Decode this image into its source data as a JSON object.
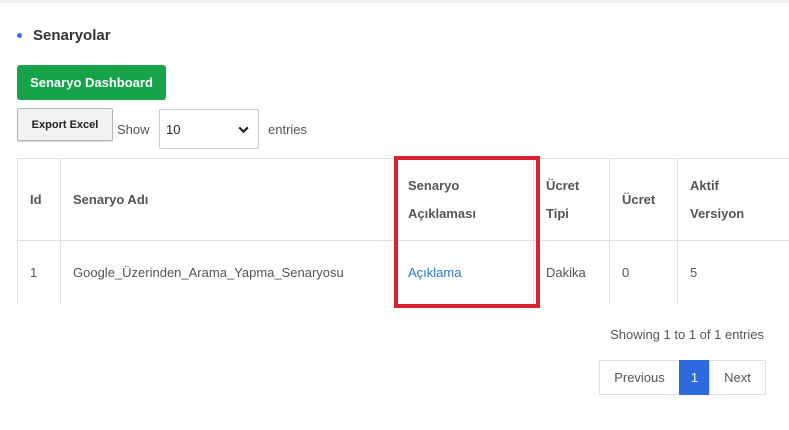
{
  "section": {
    "title": "Senaryolar"
  },
  "toolbar": {
    "dashboard_label": "Senaryo Dashboard",
    "export_label": "Export Excel"
  },
  "length_control": {
    "show_label": "Show",
    "selected": "10",
    "entries_label": "entries"
  },
  "table": {
    "columns": [
      {
        "line1": "Id",
        "line2": ""
      },
      {
        "line1": "Senaryo Adı",
        "line2": ""
      },
      {
        "line1": "Senaryo",
        "line2": "Açıklaması"
      },
      {
        "line1": "Ücret",
        "line2": "Tipi"
      },
      {
        "line1": "Ücret",
        "line2": ""
      },
      {
        "line1": "Aktif",
        "line2": "Versiyon"
      }
    ],
    "rows": [
      {
        "id": "1",
        "name": "Google_Üzerinden_Arama_Yapma_Senaryosu",
        "description_link": "Açıklama",
        "fee_type": "Dakika",
        "fee": "0",
        "active_version": "5"
      }
    ]
  },
  "info_text": "Showing 1 to 1 of 1 entries",
  "pagination": {
    "previous": "Previous",
    "current_page": "1",
    "next": "Next"
  },
  "colors": {
    "dashboard_button": "#17a34a",
    "highlight_box": "#d8232e",
    "link": "#2b79c2",
    "active_page": "#2d6cdf"
  },
  "icons": {
    "select_arrow": "chevron-down-icon",
    "section_bullet": "bullet-icon"
  }
}
